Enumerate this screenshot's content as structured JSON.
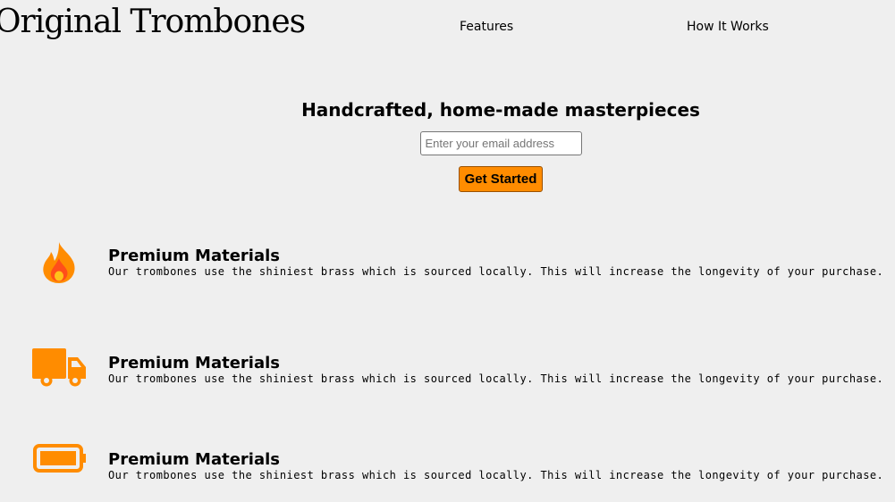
{
  "header": {
    "logo": "Original Trombones",
    "nav": [
      {
        "label": "Features"
      },
      {
        "label": "How It Works"
      }
    ]
  },
  "hero": {
    "title": "Handcrafted, home-made masterpieces",
    "email_placeholder": "Enter your email address",
    "cta_label": "Get Started"
  },
  "features": [
    {
      "icon": "fire-icon",
      "title": "Premium Materials",
      "description": "Our trombones use the shiniest brass which is sourced locally. This will increase the longevity of your purchase."
    },
    {
      "icon": "truck-icon",
      "title": "Premium Materials",
      "description": "Our trombones use the shiniest brass which is sourced locally. This will increase the longevity of your purchase."
    },
    {
      "icon": "battery-icon",
      "title": "Premium Materials",
      "description": "Our trombones use the shiniest brass which is sourced locally. This will increase the longevity of your purchase."
    }
  ],
  "colors": {
    "accent": "#ff8c00",
    "flame_inner": "#ff4e1a",
    "flame_core": "#ffc21a",
    "background": "#efefef"
  }
}
